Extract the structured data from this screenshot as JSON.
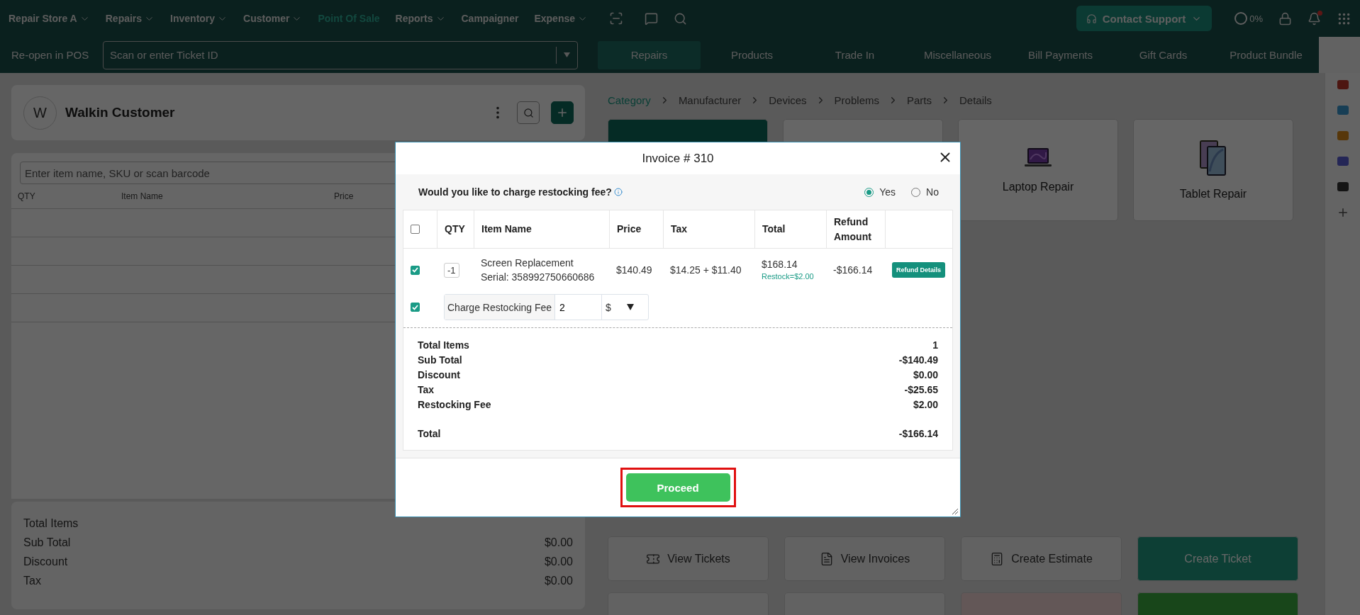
{
  "nav": {
    "items": [
      {
        "label": "Repair Store A",
        "dropdown": true,
        "selected": false
      },
      {
        "label": "Repairs",
        "dropdown": true,
        "selected": false
      },
      {
        "label": "Inventory",
        "dropdown": true,
        "selected": false
      },
      {
        "label": "Customer",
        "dropdown": true,
        "selected": false
      },
      {
        "label": "Point Of Sale",
        "dropdown": false,
        "selected": true
      },
      {
        "label": "Reports",
        "dropdown": true,
        "selected": false
      },
      {
        "label": "Campaigner",
        "dropdown": false,
        "selected": false
      },
      {
        "label": "Expense",
        "dropdown": true,
        "selected": false
      }
    ],
    "contact_support": "Contact Support",
    "progress": "0%",
    "notifications_unread": true
  },
  "pos_bar": {
    "label": "Re-open in POS",
    "ticket_placeholder": "Scan or enter Ticket ID",
    "tabs": [
      {
        "label": "Repairs",
        "selected": true
      },
      {
        "label": "Products",
        "selected": false
      },
      {
        "label": "Trade In",
        "selected": false
      },
      {
        "label": "Miscellaneous",
        "selected": false
      },
      {
        "label": "Bill Payments",
        "selected": false
      },
      {
        "label": "Gift Cards",
        "selected": false
      },
      {
        "label": "Product Bundle",
        "selected": false
      }
    ]
  },
  "customer": {
    "initial": "W",
    "name": "Walkin Customer"
  },
  "cart": {
    "search_placeholder": "Enter item name, SKU or scan barcode",
    "columns": [
      "QTY",
      "Item Name",
      "Price"
    ],
    "totals": [
      {
        "label": "Total Items"
      },
      {
        "label": "Sub Total",
        "value": "$0.00"
      },
      {
        "label": "Discount",
        "value": "$0.00"
      },
      {
        "label": "Tax",
        "value": "$0.00"
      }
    ]
  },
  "breadcrumb": [
    {
      "label": "Category",
      "selected": true
    },
    {
      "label": "Manufacturer",
      "selected": false
    },
    {
      "label": "Devices",
      "selected": false
    },
    {
      "label": "Problems",
      "selected": false
    },
    {
      "label": "Parts",
      "selected": false
    },
    {
      "label": "Details",
      "selected": false
    }
  ],
  "categories": [
    {
      "selected": true
    },
    {
      "selected": false
    },
    {
      "label": "Laptop Repair",
      "kind": "laptop",
      "selected": false
    },
    {
      "label": "Tablet Repair",
      "kind": "tablet",
      "selected": false
    }
  ],
  "actions": [
    {
      "label": "View Tickets",
      "kind": "tickets"
    },
    {
      "label": "View Invoices",
      "kind": "invoices"
    },
    {
      "label": "Create Estimate",
      "kind": "estimate"
    },
    {
      "label": "Create Ticket",
      "kind": "primary"
    }
  ],
  "actions_row_2": [
    {
      "kind": "plain"
    },
    {
      "kind": "plain"
    },
    {
      "kind": "danger"
    },
    {
      "kind": "success"
    }
  ],
  "invoice": {
    "title": "Invoice # 310",
    "question": "Would you like to charge restocking fee?",
    "options": [
      {
        "label": "Yes",
        "selected": true
      },
      {
        "label": "No",
        "selected": false
      }
    ],
    "columns": [
      "QTY",
      "Item Name",
      "Price",
      "Tax",
      "Total",
      "Refund Amount"
    ],
    "select_all": false,
    "items": [
      {
        "checked": true,
        "qty": "-1",
        "name": "Screen Replacement",
        "serial": "Serial: 358992750660686",
        "price": "$140.49",
        "tax": "$14.25 + $11.40",
        "total": "$168.14",
        "restock": "Restock=$2.00",
        "refund": "-$166.14",
        "action": "Refund Details"
      }
    ],
    "restocking": {
      "checked": true,
      "label": "Charge Restocking Fee",
      "value": "2",
      "unit": "$"
    },
    "summary": [
      {
        "label": "Total Items",
        "value": "1"
      },
      {
        "label": "Sub Total",
        "value": "-$140.49"
      },
      {
        "label": "Discount",
        "value": "$0.00"
      },
      {
        "label": "Tax",
        "value": "-$25.65"
      },
      {
        "label": "Restocking Fee",
        "value": "$2.00"
      }
    ],
    "total": {
      "label": "Total",
      "value": "-$166.14"
    },
    "proceed": "Proceed",
    "proceed_highlighted": true
  }
}
